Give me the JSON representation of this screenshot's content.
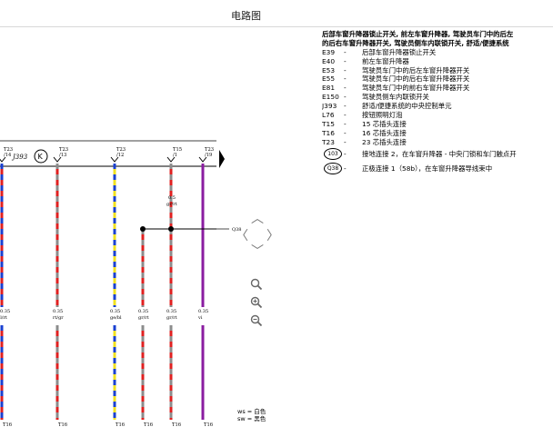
{
  "window": {
    "title": "电路图"
  },
  "diagram": {
    "component": "J393",
    "wires": [
      {
        "label": "T23\n/14",
        "gauge": "",
        "color_code": "bl/rt",
        "colors": [
          "#e02020",
          "#1a40d0"
        ],
        "bottom": "T16"
      },
      {
        "label": "T23\n/13",
        "gauge": "0.35",
        "color_code": "rt/gr",
        "colors": [
          "#e02020",
          "#8c8c8c"
        ],
        "bottom": "T16"
      },
      {
        "label": "T23\n/12",
        "gauge": "0.35",
        "color_code": "ge/bl",
        "colors": [
          "#f0e020",
          "#1a40d0"
        ],
        "bottom": "T16"
      },
      {
        "label": "",
        "gauge": "0.35",
        "color_code": "gr/rt",
        "colors": [
          "#e02020",
          "#8c8c8c"
        ],
        "bottom": "T16"
      },
      {
        "label": "T15\n/1",
        "gauge": "0.35",
        "color_code": "gr/rt",
        "colors": [
          "#e02020",
          "#8c8c8c"
        ],
        "bottom": "T16",
        "mid_gauge": "0.5",
        "mid_color": "gr/rt"
      },
      {
        "label": "T23\n/19",
        "gauge": "0.35",
        "color_code": "vi",
        "colors": [
          "#8a1ca0"
        ],
        "bottom": "T16"
      }
    ],
    "first_wire_gauge": "0.35",
    "junction_label": "Q38",
    "left_partial_label": "rt"
  },
  "legend": {
    "heading": [
      "后部车窗升降器锁止开关, 前左车窗升降器, 驾驶员车门中的后左",
      "的后右车窗升降器开关, 驾驶员侧车内联锁开关, 舒适/便捷系统"
    ],
    "items": [
      {
        "code": "E39",
        "desc": "后部车窗升降器锁止开关"
      },
      {
        "code": "E40",
        "desc": "前左车窗升降器"
      },
      {
        "code": "E53",
        "desc": "驾驶员车门中的后左车窗升降器开关"
      },
      {
        "code": "E55",
        "desc": "驾驶员车门中的后右车窗升降器开关"
      },
      {
        "code": "E81",
        "desc": "驾驶员车门中的前右车窗升降器开关"
      },
      {
        "code": "E150",
        "desc": "驾驶员侧车内联锁开关"
      },
      {
        "code": "J393",
        "desc": "舒适/便捷系统的中央控制单元"
      },
      {
        "code": "L76",
        "desc": "按钮照明灯泡"
      },
      {
        "code": "T15",
        "desc": "15 芯插头连接"
      },
      {
        "code": "T16",
        "desc": "16 芯插头连接"
      },
      {
        "code": "T23",
        "desc": "23 芯插头连接"
      }
    ],
    "rings": [
      {
        "code": "103",
        "desc": "接地连接 2，在车窗升降器 - 中央门锁和车门触点开"
      },
      {
        "code": "Q38",
        "desc": "正极连接 1（58b），在车窗升降器导线束中"
      }
    ],
    "dash": "-"
  },
  "color_key": [
    "ws = 白色",
    "sw = 黑色"
  ]
}
